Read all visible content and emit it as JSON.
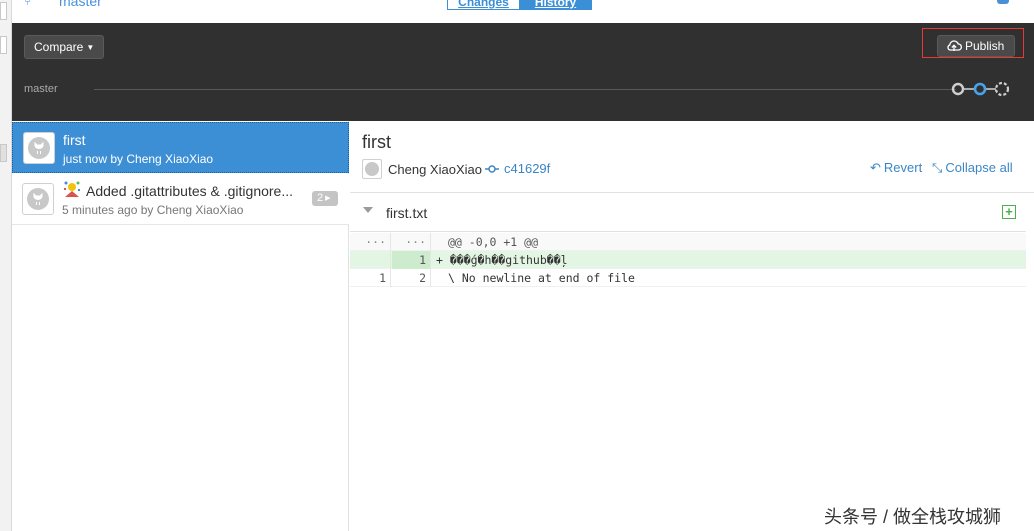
{
  "top": {
    "branch": "master",
    "tabs": [
      "Changes",
      "History"
    ],
    "active_tab": "History"
  },
  "toolbar": {
    "compare_label": "Compare",
    "publish_label": "Publish",
    "branch_label": "master"
  },
  "commits": [
    {
      "title": "first",
      "subtitle": "just now by Cheng XiaoXiao",
      "selected": true
    },
    {
      "title": "Added .gitattributes & .gitignore...",
      "subtitle": "5 minutes ago by Cheng XiaoXiao",
      "count": "2",
      "selected": false
    }
  ],
  "detail": {
    "title": "first",
    "author": "Cheng XiaoXiao",
    "sha": "c41629f",
    "revert_label": "Revert",
    "collapse_label": "Collapse all",
    "file": {
      "name": "first.txt",
      "rows": [
        {
          "type": "hunk",
          "old": "···",
          "new": "···",
          "text": "@@ -0,0 +1 @@"
        },
        {
          "type": "added",
          "old": "",
          "new": "1",
          "text": "+ ���ǵ�һ��github��ļ"
        },
        {
          "type": "context",
          "old": "1",
          "new": "2",
          "text": "\\ No newline at end of file"
        }
      ]
    }
  },
  "watermark": "头条号 / 做全栈攻城狮",
  "colors": {
    "accent": "#3c8fd5",
    "toolbar_bg": "#303030",
    "added_bg": "#e3f6e3",
    "highlight_outline": "#e53935"
  }
}
